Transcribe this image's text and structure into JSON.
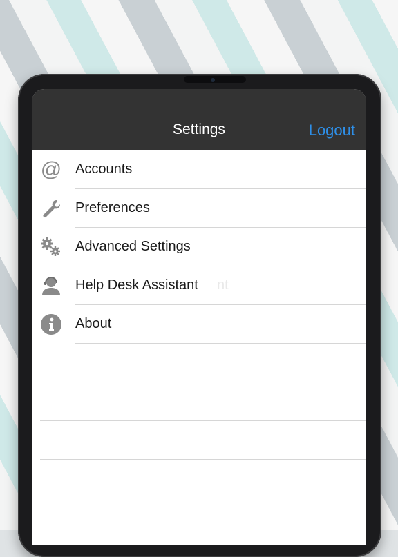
{
  "navbar": {
    "title": "Settings",
    "logout_label": "Logout"
  },
  "menu": {
    "items": [
      {
        "label": "Accounts",
        "icon": "at-icon"
      },
      {
        "label": "Preferences",
        "icon": "wrench-icon"
      },
      {
        "label": "Advanced Settings",
        "icon": "gears-icon"
      },
      {
        "label": "Help Desk Assistant",
        "icon": "support-agent-icon",
        "ghost_text": "nt"
      },
      {
        "label": "About",
        "icon": "info-icon"
      }
    ]
  },
  "colors": {
    "navbar_bg": "#333333",
    "logout_blue": "#2e8fe8",
    "icon_gray": "#8a8a8a"
  }
}
